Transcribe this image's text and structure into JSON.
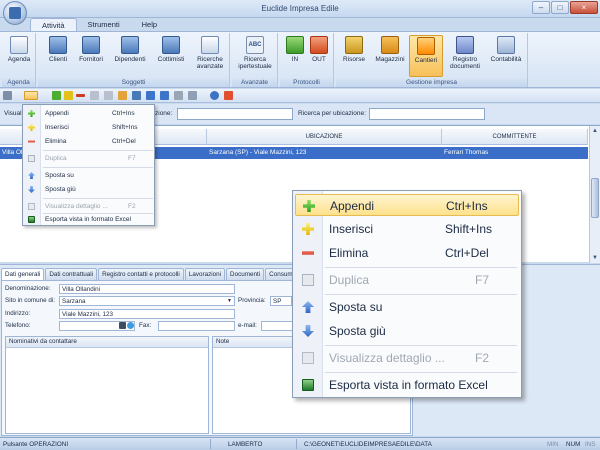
{
  "window": {
    "title": "Euclide Impresa Edile"
  },
  "ribbon_tabs": [
    "Attività",
    "Strumenti",
    "Help"
  ],
  "ribbon": {
    "groups": {
      "agenda": "Agenda",
      "soggetti": "Soggetti",
      "avanzate": "Avanzate",
      "protocolli": "Protocolli",
      "gestione": "Gestione impresa"
    },
    "buttons": {
      "agenda": "Agenda",
      "clienti": "Clienti",
      "fornitori": "Fornitori",
      "dipendenti": "Dipendenti",
      "cottimisti": "Cottimisti",
      "ricerche_avanzate_1": "Ricerche",
      "ricerche_avanzate_2": "avanzate",
      "ricerca_ipertestuale_1": "Ricerca",
      "ricerca_ipertestuale_2": "ipertestuale",
      "in": "IN",
      "out": "OUT",
      "risorse": "Risorse",
      "magazzini": "Magazzini",
      "cantieri": "Cantieri",
      "registro_documenti_1": "Registro",
      "registro_documenti_2": "documenti",
      "contabilita": "Contabilità"
    },
    "icon_abc": "ABC"
  },
  "filter": {
    "visualizza_label": "Visuali",
    "ubicazione_fragment": "zione:",
    "ricerca_ubicazione_label": "Ricerca per ubicazione:"
  },
  "grid": {
    "columns": {
      "ubicazione": "UBICAZIONE",
      "committente": "COMMITTENTE"
    },
    "rows": [
      {
        "denominazione": "Villa Olla",
        "ubicazione": "Sarzana (SP) - Viale Mazzini, 123",
        "committente": "Ferrari Thomas"
      }
    ]
  },
  "detail": {
    "tabs": [
      "Dati generali",
      "Dati contrattuali",
      "Registro contatti e protocolli",
      "Lavorazioni",
      "Documenti",
      "Consumi"
    ],
    "denominazione_label": "Denominazione:",
    "denominazione_value": "Villa Ollandini",
    "sito_label": "Sito in comune di:",
    "sito_value": "Sarzana",
    "provincia_label": "Provincia:",
    "provincia_value": "SP",
    "indirizzo_label": "Indirizzo:",
    "indirizzo_value": "Viale Mazzini, 123",
    "telefono_label": "Telefono:",
    "fax_label": "Fax:",
    "email_label": "e-mail:",
    "nominativi_label": "Nominativi da contattare",
    "note_label": "Note"
  },
  "context_menu": {
    "items": [
      {
        "label": "Appendi",
        "shortcut": "Ctrl+Ins",
        "icon": "plus-green-icon",
        "disabled": false
      },
      {
        "label": "Inserisci",
        "shortcut": "Shift+Ins",
        "icon": "plus-yellow-icon",
        "disabled": false
      },
      {
        "label": "Elimina",
        "shortcut": "Ctrl+Del",
        "icon": "minus-red-icon",
        "disabled": false
      },
      {
        "label": "Duplica",
        "shortcut": "F7",
        "icon": "duplicate-icon",
        "disabled": true
      },
      {
        "label": "Sposta su",
        "shortcut": "",
        "icon": "arrow-up-icon",
        "disabled": false
      },
      {
        "label": "Sposta giù",
        "shortcut": "",
        "icon": "arrow-down-icon",
        "disabled": false
      },
      {
        "label": "Visualizza dettaglio ...",
        "shortcut": "F2",
        "icon": "view-detail-icon",
        "disabled": true
      },
      {
        "label": "Esporta vista in formato Excel",
        "shortcut": "",
        "icon": "excel-icon",
        "disabled": false
      }
    ],
    "highlighted": "Appendi"
  },
  "statusbar": {
    "left": "Pulsante OPERAZIONI",
    "user": "LAMBERTO",
    "path": "C:\\GEONET\\EUCLIDEIMPRESAEDILE\\DATA",
    "min": "MIN",
    "num": "NUM",
    "ins": "INS"
  },
  "colors": {
    "selection": "#3a6ec8",
    "ribbon": "#d5e3f4",
    "highlight": "#fde18b"
  }
}
